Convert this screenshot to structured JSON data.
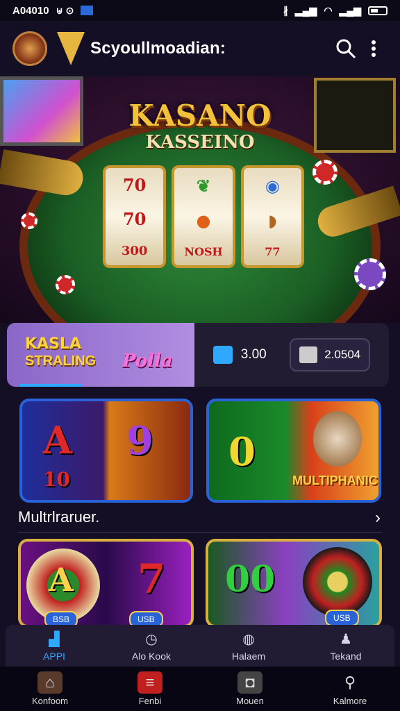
{
  "status_bar": {
    "time": "A04010",
    "icons": [
      "signal-icon",
      "wifi-icon",
      "battery-icon"
    ]
  },
  "app_bar": {
    "title": "Scyoullmoadian:"
  },
  "hero": {
    "title": "KASANO",
    "subtitle": "KASSEINO",
    "reel_symbols": [
      [
        "70",
        "70",
        "300"
      ],
      [
        "",
        "NOSH",
        ""
      ],
      [
        "",
        "",
        ""
      ]
    ]
  },
  "promo": {
    "title_line1": "KASLA",
    "title_line2": "STRALING",
    "brand": "Polla",
    "balance": "3.00",
    "bonus": "2.0504"
  },
  "games": [
    {
      "label": "A 10"
    },
    {
      "label": "MULTIPHANICX"
    },
    {
      "label": "A",
      "badge": "BSB"
    },
    {
      "label": "00",
      "badge": "USB"
    }
  ],
  "section": {
    "title": "Multrlraruer."
  },
  "bottom_nav": [
    {
      "label": "APPI",
      "active": true
    },
    {
      "label": "Alo Kook",
      "active": false
    },
    {
      "label": "Halaem",
      "active": false
    },
    {
      "label": "Tekand",
      "active": false
    }
  ],
  "dock": [
    {
      "label": "Konfoom"
    },
    {
      "label": "Fenbi"
    },
    {
      "label": "Mouen"
    },
    {
      "label": "Kalmore"
    }
  ],
  "colors": {
    "accent": "#2fa8ff",
    "gold": "#f2c23c",
    "background": "#140f24"
  }
}
